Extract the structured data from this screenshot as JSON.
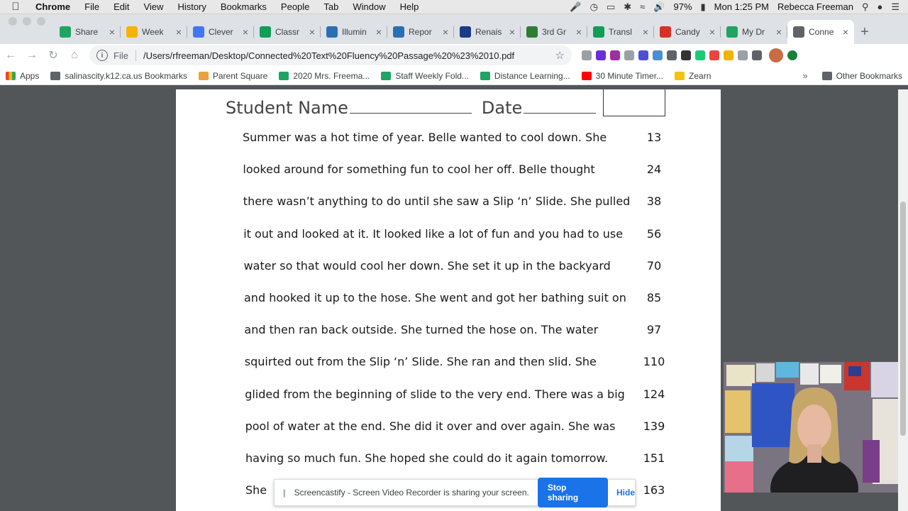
{
  "menubar": {
    "app": "Chrome",
    "items": [
      "File",
      "Edit",
      "View",
      "History",
      "Bookmarks",
      "People",
      "Tab",
      "Window",
      "Help"
    ],
    "battery": "97%",
    "clock": "Mon 1:25 PM",
    "user": "Rebecca Freeman"
  },
  "tabs": [
    {
      "label": "Share",
      "icon": "drive-icon",
      "color": "#1fa463"
    },
    {
      "label": "Week",
      "icon": "slides-icon",
      "color": "#f4b400"
    },
    {
      "label": "Clever",
      "icon": "clever-icon",
      "color": "#4274f6"
    },
    {
      "label": "Classr",
      "icon": "classroom-icon",
      "color": "#0f9d58"
    },
    {
      "label": "Illumin",
      "icon": "illuminate-icon",
      "color": "#2a6fb5"
    },
    {
      "label": "Repor",
      "icon": "illuminate-icon",
      "color": "#2a6fb5"
    },
    {
      "label": "Renais",
      "icon": "renaissance-icon",
      "color": "#1b3c87"
    },
    {
      "label": "3rd Gr",
      "icon": "shield-icon",
      "color": "#2e7d32"
    },
    {
      "label": "Transl",
      "icon": "sheets-icon",
      "color": "#0f9d58"
    },
    {
      "label": "Candy",
      "icon": "gmail-icon",
      "color": "#d93025"
    },
    {
      "label": "My Dr",
      "icon": "drive-icon",
      "color": "#1fa463"
    },
    {
      "label": "Conne",
      "icon": "globe-icon",
      "color": "#5f6368",
      "active": true
    }
  ],
  "toolbar": {
    "scheme": "File",
    "url": "/Users/rfreeman/Desktop/Connected%20Text%20Fluency%20Passage%20%23%2010.pdf"
  },
  "bookmarks": {
    "apps_label": "Apps",
    "items": [
      {
        "label": "salinascity.k12.ca.us Bookmarks",
        "icon": "folder-icon",
        "color": "#5f6368"
      },
      {
        "label": "Parent Square",
        "icon": "parentsquare-icon",
        "color": "#e8a33c"
      },
      {
        "label": "2020 Mrs. Freema...",
        "icon": "drive-icon",
        "color": "#1fa463"
      },
      {
        "label": "Staff Weekly Fold...",
        "icon": "drive-icon",
        "color": "#1fa463"
      },
      {
        "label": "Distance Learning...",
        "icon": "drive-icon",
        "color": "#1fa463"
      },
      {
        "label": "30 Minute Timer...",
        "icon": "youtube-icon",
        "color": "#ff0000"
      },
      {
        "label": "Zearn",
        "icon": "zearn-icon",
        "color": "#f4c20d"
      }
    ],
    "other_label": "Other Bookmarks"
  },
  "document": {
    "student_name_label": "Student Name",
    "date_label": "Date",
    "lines": [
      {
        "text": "Summer was a hot time of year. Belle wanted to cool down.  She",
        "count": "13"
      },
      {
        "text": "looked around for something fun to cool her off.  Belle thought",
        "count": "24"
      },
      {
        "text": "there wasn’t anything to do until she saw a Slip ‘n’ Slide.  She pulled",
        "count": "38"
      },
      {
        "text": "it out and looked at it.  It looked like a lot of fun and you had to use",
        "count": "56"
      },
      {
        "text": "water so that would cool her down.  She set it up in the backyard",
        "count": "70"
      },
      {
        "text": "and hooked it up to the hose.  She went and got her bathing suit on",
        "count": "85"
      },
      {
        "text": "and then ran back outside.  She turned the hose on.  The water",
        "count": "97"
      },
      {
        "text": "squirted out from the Slip ‘n’ Slide.  She ran and then slid.  She",
        "count": "110"
      },
      {
        "text": "glided from the beginning of slide to the very end. There was a big",
        "count": "124"
      },
      {
        "text": "pool of water at the end.  She did it over and over again.  She was",
        "count": "139"
      },
      {
        "text": "having so much fun.  She hoped she could do it again tomorrow.",
        "count": "151"
      },
      {
        "text": "She",
        "count": "163"
      }
    ]
  },
  "sharebar": {
    "message": "Screencastify - Screen Video Recorder is sharing your screen.",
    "stop_label": "Stop sharing",
    "hide_label": "Hide"
  }
}
